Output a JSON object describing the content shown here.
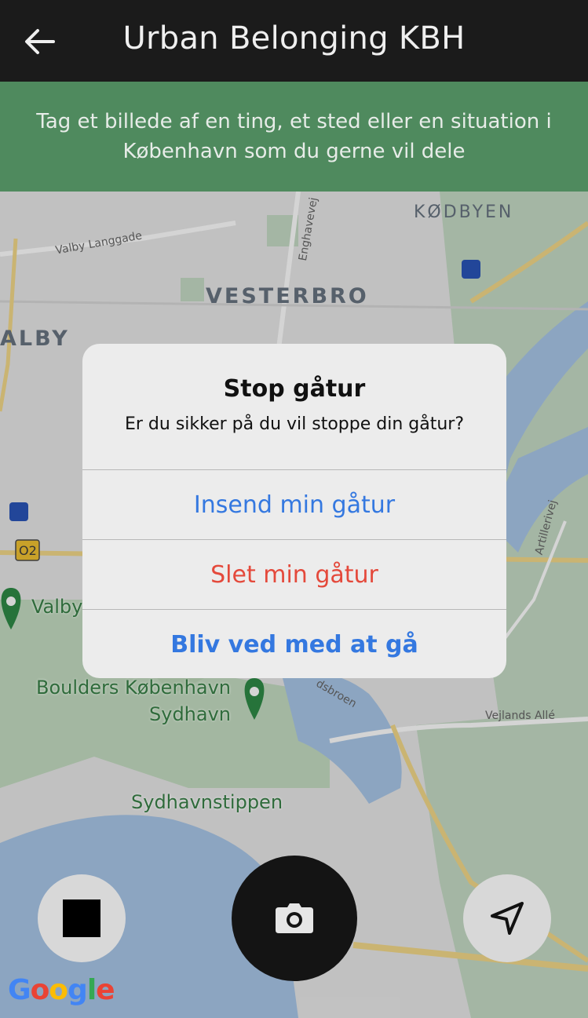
{
  "header": {
    "title": "Urban Belonging KBH",
    "back_icon": "arrow-left-icon"
  },
  "banner": {
    "text": "Tag et billede af en ting, et sted eller en situation i København som du gerne vil dele"
  },
  "map": {
    "labels": {
      "kodbyen": "KØDBYEN",
      "vesterbro": "VESTERBRO",
      "valby_partial": "ALBY",
      "valby_langgade": "Valby Langgade",
      "enghavevej": "Enghavevej",
      "artillerivej": "Artillerivej",
      "vejlands_alle": "Vejlands Allé",
      "sydhavnstippen": "Sydhavnstippen",
      "valby_place": "Valby",
      "boulders_line1": "Boulders København",
      "boulders_line2": "Sydhavn",
      "o2_badge": "O2",
      "bridge_partial": "dsbroen"
    }
  },
  "dialog": {
    "title": "Stop gåtur",
    "message": "Er du sikker på du vil stoppe din gåtur?",
    "buttons": {
      "submit": "Insend min gåtur",
      "delete": "Slet min gåtur",
      "continue": "Bliv ved med at gå"
    }
  },
  "controls": {
    "stop_icon": "stop-square-icon",
    "camera_icon": "camera-icon",
    "navigate_icon": "navigation-arrow-icon"
  },
  "branding": {
    "google_logo": "Google"
  },
  "colors": {
    "header_bg": "#1b1b1b",
    "banner_bg": "#4f8a5e",
    "blue_action": "#3478e0",
    "red_action": "#e4493b"
  }
}
